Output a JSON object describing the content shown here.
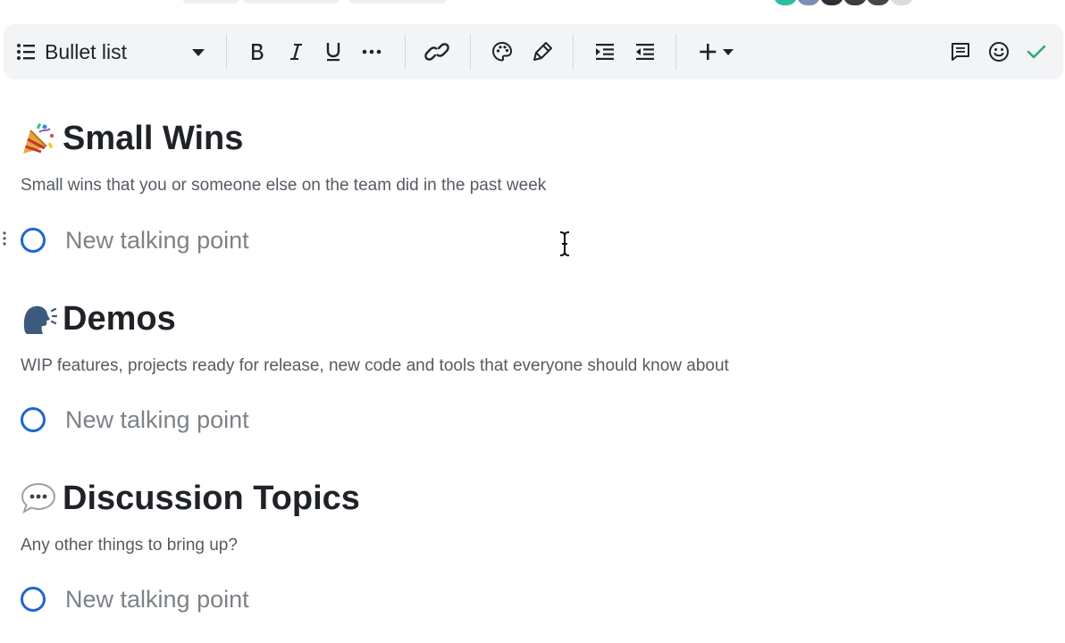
{
  "toolbar": {
    "block_style": {
      "icon": "bulleted-list-icon",
      "label": "Bullet list"
    },
    "buttons": [
      {
        "name": "bold",
        "icon": "bold-icon"
      },
      {
        "name": "italic",
        "icon": "italic-icon"
      },
      {
        "name": "underline",
        "icon": "underline-icon"
      },
      {
        "name": "more-formatting",
        "icon": "more-horizontal-icon"
      },
      {
        "name": "link",
        "icon": "link-icon"
      },
      {
        "name": "text-color",
        "icon": "palette-icon"
      },
      {
        "name": "highlight",
        "icon": "highlighter-icon"
      },
      {
        "name": "indent",
        "icon": "indent-icon"
      },
      {
        "name": "outdent",
        "icon": "outdent-icon"
      },
      {
        "name": "insert",
        "icon": "plus-dropdown-icon"
      },
      {
        "name": "comment",
        "icon": "comment-icon"
      },
      {
        "name": "emoji",
        "icon": "smiley-icon"
      },
      {
        "name": "done",
        "icon": "checkmark-icon"
      }
    ]
  },
  "colors": {
    "accent_blue": "#1f66d1",
    "check_green": "#2aa86a",
    "toolbar_bg": "#f3f4f6"
  },
  "sections": [
    {
      "emoji": "party-popper-icon",
      "title": "Small Wins",
      "description": "Small wins that you or someone else on the team did in the past week",
      "talking_point": "New talking point"
    },
    {
      "emoji": "speaking-head-icon",
      "title": "Demos",
      "description": "WIP features, projects ready for release, new code and tools that everyone should know about",
      "talking_point": "New talking point"
    },
    {
      "emoji": "speech-bubble-icon",
      "title": "Discussion Topics",
      "description": "Any other things to bring up?",
      "talking_point": "New talking point"
    }
  ]
}
